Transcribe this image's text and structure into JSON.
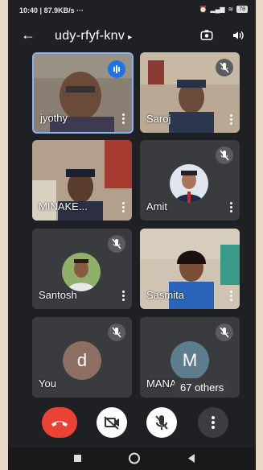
{
  "status_bar": {
    "time": "10:40",
    "speed": "87.9KB/s",
    "extra": "···",
    "battery": "78"
  },
  "header": {
    "meeting_code": "udy-rfyf-knv",
    "caret": "▸"
  },
  "participants": [
    {
      "name": "jyothy",
      "muted": false,
      "speaking": true,
      "type": "video"
    },
    {
      "name": "Saroj",
      "muted": true,
      "type": "video"
    },
    {
      "name": "MINAKE...",
      "muted": false,
      "type": "video"
    },
    {
      "name": "Amit",
      "muted": true,
      "type": "photo"
    },
    {
      "name": "Santosh",
      "muted": true,
      "type": "photo"
    },
    {
      "name": "Sasmita",
      "muted": false,
      "type": "video"
    },
    {
      "name": "You",
      "letter": "d",
      "muted": true,
      "type": "letter",
      "color": "#8d6e63"
    },
    {
      "name": "MANASLATA",
      "letter": "M",
      "muted": true,
      "type": "letter",
      "color": "#5d7d8c"
    }
  ],
  "others_chip": "67 others",
  "colors": {
    "end_call": "#ea4335",
    "speaking": "#1a73e8"
  }
}
